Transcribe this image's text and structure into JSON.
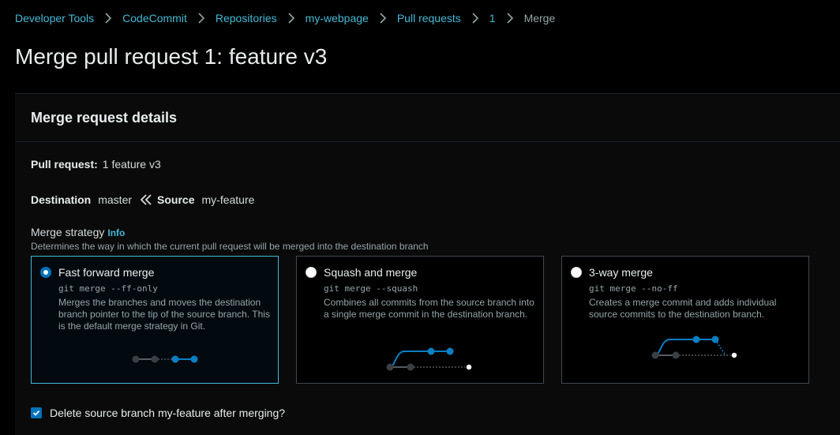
{
  "breadcrumb": {
    "items": [
      "Developer Tools",
      "CodeCommit",
      "Repositories",
      "my-webpage",
      "Pull requests",
      "1"
    ],
    "current": "Merge"
  },
  "page": {
    "title": "Merge pull request 1: feature v3"
  },
  "panel": {
    "title": "Merge request details",
    "pull_request_label": "Pull request:",
    "pull_request_value": "1 feature v3",
    "destination_label": "Destination",
    "destination_value": "master",
    "source_label": "Source",
    "source_value": "my-feature"
  },
  "strategy": {
    "title": "Merge strategy",
    "info": "Info",
    "description": "Determines the way in which the current pull request will be merged into the destination branch",
    "options": [
      {
        "title": "Fast forward merge",
        "command": "git merge --ff-only",
        "description": "Merges the branches and moves the destination branch pointer to the tip of the source branch. This is the default merge strategy in Git.",
        "selected": true
      },
      {
        "title": "Squash and merge",
        "command": "git merge --squash",
        "description": "Combines all commits from the source branch into a single merge commit in the destination branch.",
        "selected": false
      },
      {
        "title": "3-way merge",
        "command": "git merge --no-ff",
        "description": "Creates a merge commit and adds individual source commits to the destination branch.",
        "selected": false
      }
    ]
  },
  "delete_branch": {
    "label": "Delete source branch my-feature after merging?",
    "checked": true
  },
  "colors": {
    "link": "#44b9d6",
    "accent": "#0073bb",
    "background": "#000000",
    "card_border": "#414750"
  },
  "icons": {
    "separator": "chevron-right-icon",
    "direction": "double-chevron-left-icon",
    "check": "checkmark-icon"
  }
}
